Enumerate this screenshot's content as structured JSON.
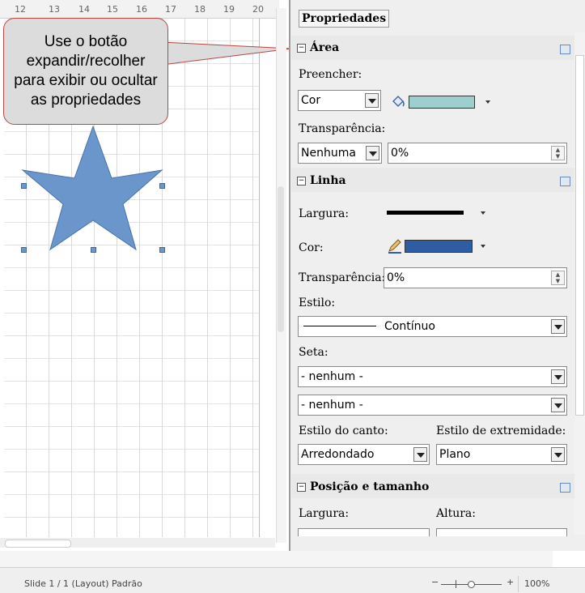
{
  "ruler": {
    "ticks": [
      "12",
      "13",
      "14",
      "15",
      "16",
      "17",
      "18",
      "19",
      "20"
    ]
  },
  "callout": {
    "text": "Use o botão expandir/recolher para exibir ou ocultar as propriedades"
  },
  "sidebar": {
    "title": "Propriedades",
    "area": {
      "title": "Área",
      "fill_label": "Preencher:",
      "fill_value": "Cor",
      "fill_color": "#9dcfcf",
      "transparency_label": "Transparência:",
      "transparency_mode": "Nenhuma",
      "transparency_value": "0%"
    },
    "line": {
      "title": "Linha",
      "width_label": "Largura:",
      "color_label": "Cor:",
      "line_color": "#2f5da3",
      "transparency_label": "Transparência:",
      "transparency_value": "0%",
      "style_label": "Estilo:",
      "style_value": "Contínuo",
      "arrow_label": "Seta:",
      "arrow_start": "- nenhum -",
      "arrow_end": "- nenhum -",
      "corner_label": "Estilo do canto:",
      "corner_value": "Arredondado",
      "cap_label": "Estilo de extremidade:",
      "cap_value": "Plano"
    },
    "position": {
      "title": "Posição e tamanho",
      "width_label": "Largura:",
      "height_label": "Altura:"
    }
  },
  "status": {
    "slide": "Slide 1 / 1 (Layout)",
    "master": "Padrão",
    "zoom": "100%"
  },
  "colors": {
    "star_fill": "#6a96cc",
    "star_stroke": "#4a72a8"
  },
  "icons": [
    "bucket-icon",
    "pencil-icon",
    "collapse-icon",
    "more-options-icon"
  ]
}
